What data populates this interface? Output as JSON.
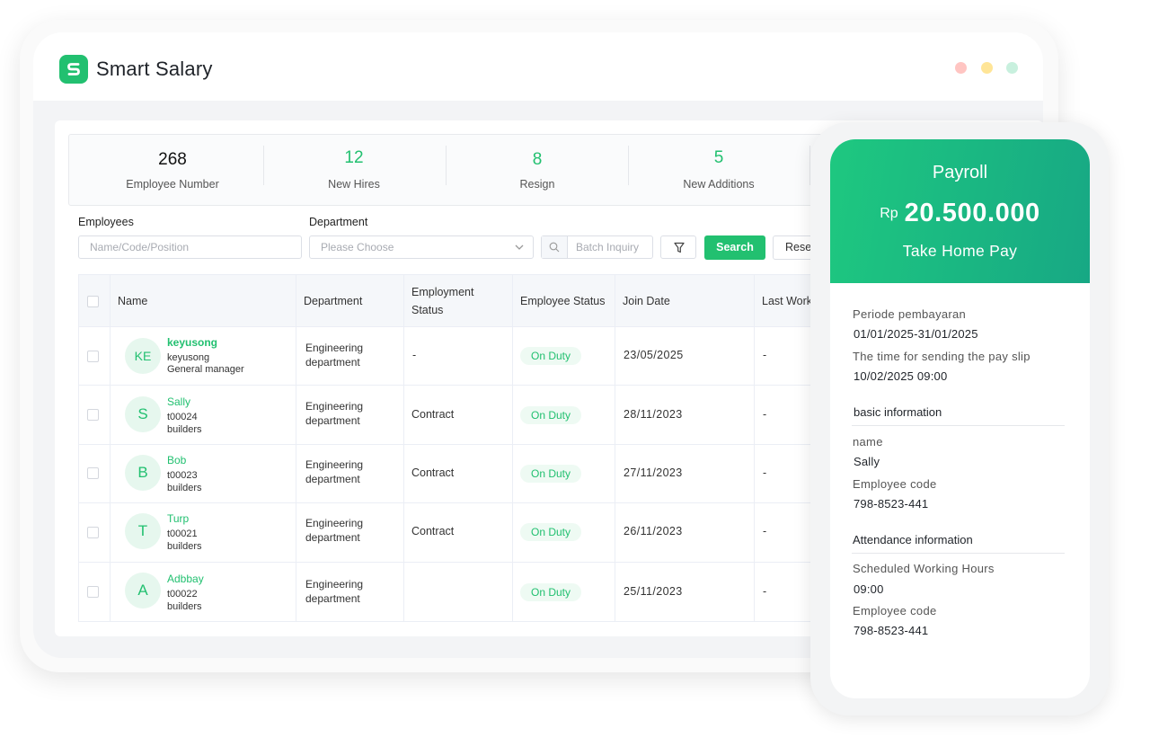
{
  "app": {
    "title": "Smart Salary",
    "logo_letter": "S"
  },
  "colors": {
    "accent": "#22c070",
    "accent_dark": "#17a884",
    "badge_bg": "#eefaf3"
  },
  "window_controls": [
    {
      "name": "close",
      "color": "#ffc5c2"
    },
    {
      "name": "minimize",
      "color": "#ffe597"
    },
    {
      "name": "maximize",
      "color": "#c8f0de"
    }
  ],
  "stats": [
    {
      "value": "268",
      "label": "Employee Number",
      "highlight": false
    },
    {
      "value": "12",
      "label": "New Hires",
      "highlight": true
    },
    {
      "value": "8",
      "label": "Resign",
      "highlight": true
    },
    {
      "value": "5",
      "label": "New Additions",
      "highlight": true
    }
  ],
  "filters": {
    "employees_label": "Employees",
    "employees_placeholder": "Name/Code/Position",
    "department_label": "Department",
    "department_placeholder": "Please Choose",
    "batch_placeholder": "Batch Inquiry",
    "search_label": "Search",
    "reset_label": "Reset"
  },
  "table": {
    "headers": [
      "Name",
      "Department",
      "Employment Status",
      "Employee Status",
      "Join Date",
      "Last Work"
    ],
    "rows": [
      {
        "initials": "KE",
        "name": "keyusong",
        "code": "keyusong",
        "position": "General manager",
        "department": "Engineering department",
        "employment": "-",
        "status": "On Duty",
        "join_date": "23/05/2025",
        "last_work": "-"
      },
      {
        "initials": "S",
        "name": "Sally",
        "code": "t00024",
        "position": "builders",
        "department": "Engineering department",
        "employment": "Contract",
        "status": "On Duty",
        "join_date": "28/11/2023",
        "last_work": "-"
      },
      {
        "initials": "B",
        "name": "Bob",
        "code": "t00023",
        "position": "builders",
        "department": "Engineering department",
        "employment": "Contract",
        "status": "On Duty",
        "join_date": "27/11/2023",
        "last_work": "-"
      },
      {
        "initials": "T",
        "name": "Turp",
        "code": "t00021",
        "position": "builders",
        "department": "Engineering department",
        "employment": "Contract",
        "status": "On Duty",
        "join_date": "26/11/2023",
        "last_work": "-"
      },
      {
        "initials": "A",
        "name": "Adbbay",
        "code": "t00022",
        "position": "builders",
        "department": "Engineering department",
        "employment": "",
        "status": "On Duty",
        "join_date": "25/11/2023",
        "last_work": "-"
      }
    ]
  },
  "payslip": {
    "title": "Payroll",
    "currency": "Rp",
    "amount": "20.500.000",
    "subtitle": "Take Home Pay",
    "period_label": "Periode pembayaran",
    "period_value": "01/01/2025-31/01/2025",
    "send_time_label": "The time for sending the pay slip",
    "send_time_value": "10/02/2025 09:00",
    "basic_title": "basic information",
    "name_label": "name",
    "name_value": "Sally",
    "code_label": "Employee code",
    "code_value": "798-8523-441",
    "attendance_title": "Attendance information",
    "hours_label": "Scheduled Working Hours",
    "hours_value": "09:00",
    "code2_label": "Employee code",
    "code2_value": "798-8523-441"
  }
}
